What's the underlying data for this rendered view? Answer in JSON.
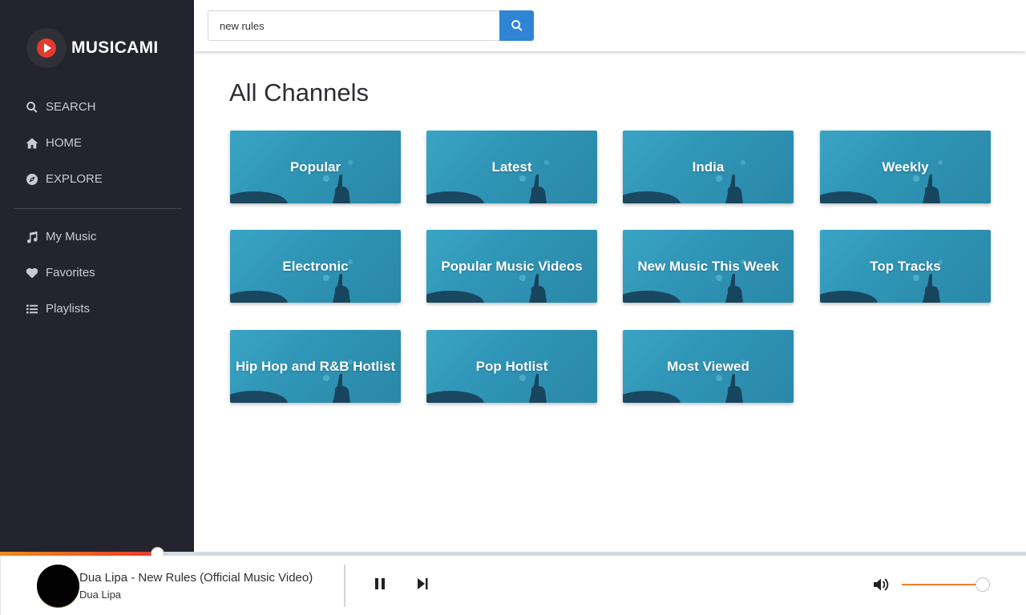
{
  "app": {
    "name": "MUSICAMI"
  },
  "sidebar": {
    "nav_top": [
      {
        "label": "SEARCH",
        "icon": "search-icon"
      },
      {
        "label": "HOME",
        "icon": "home-icon"
      },
      {
        "label": "EXPLORE",
        "icon": "explore-icon"
      }
    ],
    "nav_bottom": [
      {
        "label": "My Music",
        "icon": "music-note-icon"
      },
      {
        "label": "Favorites",
        "icon": "heart-icon"
      },
      {
        "label": "Playlists",
        "icon": "list-icon"
      }
    ]
  },
  "search": {
    "value": "new rules",
    "button_icon": "search-icon"
  },
  "main": {
    "title": "All Channels",
    "channels": [
      "Popular",
      "Latest",
      "India",
      "Weekly",
      "Electronic",
      "Popular Music Videos",
      "New Music This Week",
      "Top Tracks",
      "Hip Hop and R&B Hotlist",
      "Pop Hotlist",
      "Most Viewed"
    ]
  },
  "player": {
    "title": "Dua Lipa - New Rules (Official Music Video)",
    "artist": "Dua Lipa",
    "progress": 0.153,
    "volume": 0.99,
    "controls": [
      "pause-icon",
      "next-icon"
    ],
    "volume_icon": "volume-icon"
  },
  "colors": {
    "sidebar_bg": "#23242e",
    "accent_blue": "#2f84d4",
    "card_teal": "#3aa4c4",
    "progress_orange": "#f08c1a",
    "progress_red": "#e8392a"
  }
}
